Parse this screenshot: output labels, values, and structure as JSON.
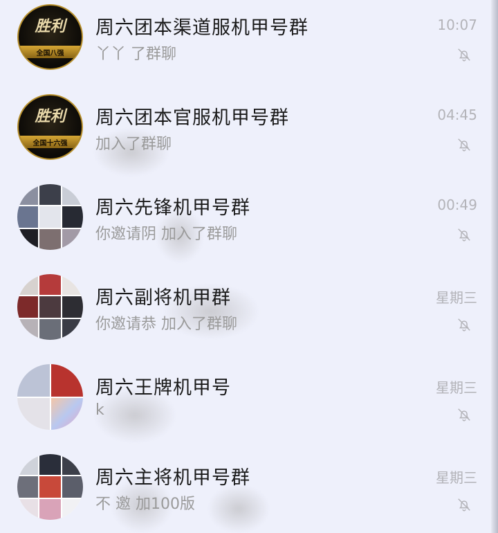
{
  "chats": [
    {
      "title": "周六团本渠道服机甲号群",
      "preview": "丫丫        了群聊",
      "time": "10:07",
      "avatar": "logo",
      "logo_text": "胜利",
      "logo_caption": "全国八强"
    },
    {
      "title": "周六团本官服机甲号群",
      "preview": "       加入了群聊",
      "time": "04:45",
      "avatar": "logo",
      "logo_text": "胜利",
      "logo_caption": "全国十六强"
    },
    {
      "title": "周六先锋机甲号群",
      "preview": "你邀请阴    加入了群聊",
      "time": "00:49",
      "avatar": "grid"
    },
    {
      "title": "周六副将机甲群",
      "preview": "你邀请恭        加入了群聊",
      "time": "星期三",
      "avatar": "grid"
    },
    {
      "title": "周六王牌机甲号",
      "preview": "           k",
      "time": "星期三",
      "avatar": "grid2"
    },
    {
      "title": "周六主将机甲号群",
      "preview": "不               邀      加100版",
      "time": "星期三",
      "avatar": "grid"
    }
  ],
  "icons": {
    "mute": "bell-off-icon"
  }
}
